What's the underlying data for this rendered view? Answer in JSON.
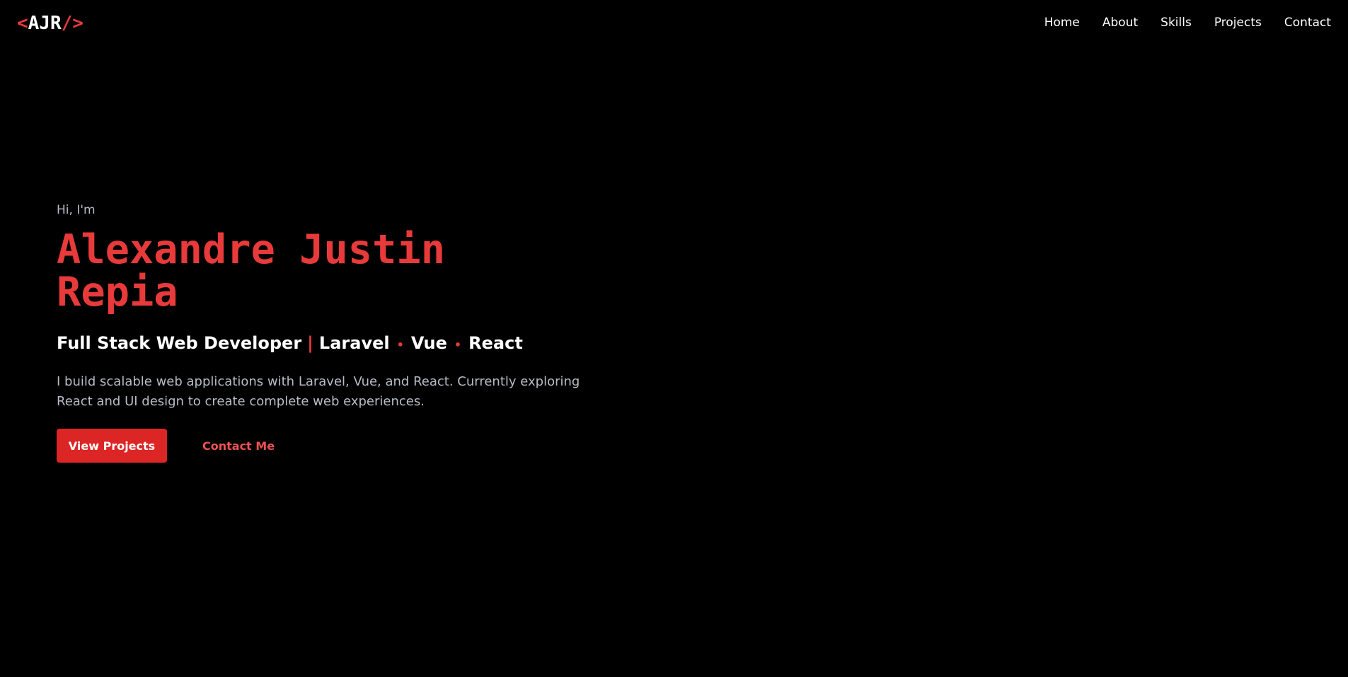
{
  "colors": {
    "background": "#000000",
    "accent": "#e83a3a",
    "button_bg": "#dc2626",
    "muted_text": "#b7bcc6"
  },
  "logo": {
    "open": "<",
    "initials": "AJR",
    "slash": "/",
    "close": ">"
  },
  "nav": {
    "items": [
      "Home",
      "About",
      "Skills",
      "Projects",
      "Contact"
    ]
  },
  "hero": {
    "greeting": "Hi, I'm",
    "name_line1": "Alexandre Justin",
    "name_line2": "Repia",
    "tagline": {
      "role": "Full Stack Web Developer",
      "bar": "|",
      "tech": [
        "Laravel",
        "Vue",
        "React"
      ],
      "dot": "•"
    },
    "description": "I build scalable web applications with Laravel, Vue, and React. Currently exploring React and UI design to create complete web experiences.",
    "primary_button": "View Projects",
    "secondary_button": "Contact Me"
  }
}
